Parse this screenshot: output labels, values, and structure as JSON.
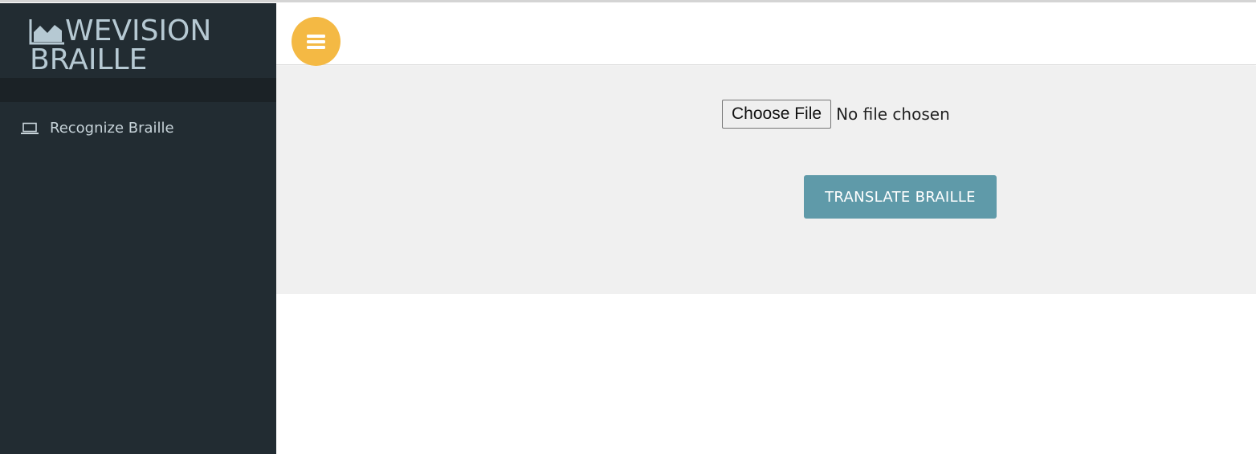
{
  "brand": {
    "title_line1": "WEVISION",
    "title_line2": "BRAILLE",
    "icon": "area-chart-icon"
  },
  "sidebar": {
    "items": [
      {
        "label": "Recognize Braille",
        "icon": "laptop-icon"
      }
    ]
  },
  "topbar": {
    "menu_icon": "hamburger-menu-icon"
  },
  "upload": {
    "button_label": "Choose File",
    "status_text": "No file chosen"
  },
  "actions": {
    "translate_label": "TRANSLATE BRAILLE"
  },
  "colors": {
    "sidebar_bg": "#222c32",
    "menu_button": "#f4b944",
    "translate_button": "#5f9aa9",
    "content_bg": "#f0f0f0"
  }
}
